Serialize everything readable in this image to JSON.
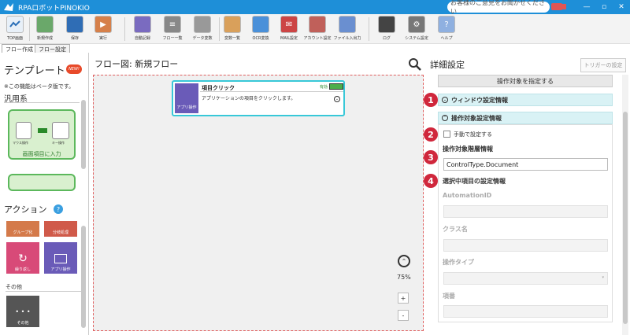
{
  "app": {
    "title": "RPAロボットPINOKIO",
    "feedback": "お客様のご意見をお聞かせください",
    "window_controls": [
      "—",
      "▫",
      "✕"
    ]
  },
  "toolbar": [
    {
      "label": "TOP画面",
      "icon": "home-icon",
      "color": "#e8f0f8"
    },
    {
      "label": "新規作成",
      "icon": "new-file-icon",
      "color": "#6aa86a"
    },
    {
      "label": "保存",
      "icon": "save-icon",
      "color": "#2f6db5"
    },
    {
      "label": "実行",
      "icon": "run-icon",
      "color": "#d6804a"
    },
    {
      "label": "自動記録",
      "icon": "record-icon",
      "color": "#7a6bc0"
    },
    {
      "label": "フロー一覧",
      "icon": "flow-list-icon",
      "color": "#888888"
    },
    {
      "label": "データ変数",
      "icon": "data-variable-icon",
      "color": "#999999"
    },
    {
      "label": "変数一覧",
      "icon": "variable-list-icon",
      "color": "#d9a05b"
    },
    {
      "label": "OCR変換",
      "icon": "ocr-icon",
      "color": "#4a90d9"
    },
    {
      "label": "MAIL設定",
      "icon": "mail-icon",
      "color": "#cc4444"
    },
    {
      "label": "アカウント設定",
      "icon": "account-icon",
      "color": "#c0605a"
    },
    {
      "label": "ファイル入出力",
      "icon": "file-io-icon",
      "color": "#6a8fd0"
    },
    {
      "label": "ログ",
      "icon": "log-icon",
      "color": "#444444"
    },
    {
      "label": "システム設定",
      "icon": "system-settings-icon",
      "color": "#777777"
    },
    {
      "label": "ヘルプ",
      "icon": "help-icon",
      "color": "#8fb0e0"
    }
  ],
  "tabs": [
    "フロー作成",
    "フロー設定"
  ],
  "left": {
    "template_title": "テンプレート",
    "new_badge": "NEW!",
    "beta_note": "※この機能はベータ版です。",
    "category": "汎用系",
    "template_cards": [
      {
        "name": "画面項目に入力",
        "sub_left": "マウス操作",
        "sub_right": "キー操作"
      },
      {
        "name": ""
      }
    ],
    "action_title": "アクション",
    "help": "?",
    "actions": [
      {
        "label": "グループ化",
        "color": "#d47a4a",
        "icon": "group-icon"
      },
      {
        "label": "分岐処理",
        "color": "#d05a4a",
        "icon": "branch-icon"
      },
      {
        "label": "繰り返し",
        "color": "#d84a78",
        "icon": "loop-icon"
      },
      {
        "label": "アプリ操作",
        "color": "#6a5bb8",
        "icon": "app-operation-icon"
      }
    ],
    "other_label": "その他",
    "other_tile": {
      "label": "その他",
      "color": "#555555",
      "icon": "more-icon",
      "glyph": "• • •"
    }
  },
  "center": {
    "title": "フロー図: 新規フロー",
    "node": {
      "icon_label": "アプリ操作",
      "title": "項目クリック",
      "description": "アプリケーションの項目をクリックします。",
      "enabled_label": "有効",
      "expand": "⌄"
    },
    "zoom_level": "75%",
    "zoom_in": "+",
    "zoom_out": "-",
    "zoom_up": "⌃"
  },
  "right": {
    "title": "詳細設定",
    "trigger_button": "トリガーの設定",
    "specify_button": "操作対象を指定する",
    "section_window": "ウィンドウ設定情報",
    "section_target": "操作対象設定情報",
    "manual_checkbox": "手動で設定する",
    "hierarchy_label": "操作対象階層情報",
    "hierarchy_value": "ControlType.Document",
    "selected_label": "選択中項目の設定情報",
    "fields": [
      {
        "label": "AutomationID",
        "value": ""
      },
      {
        "label": "クラス名",
        "value": ""
      },
      {
        "label": "操作タイプ",
        "value": ""
      },
      {
        "label": "項番",
        "value": ""
      }
    ],
    "markers": [
      "1",
      "2",
      "3",
      "4"
    ],
    "chevron_down": "⌄",
    "chevron_up": "⌃",
    "select_caret": "▾"
  }
}
